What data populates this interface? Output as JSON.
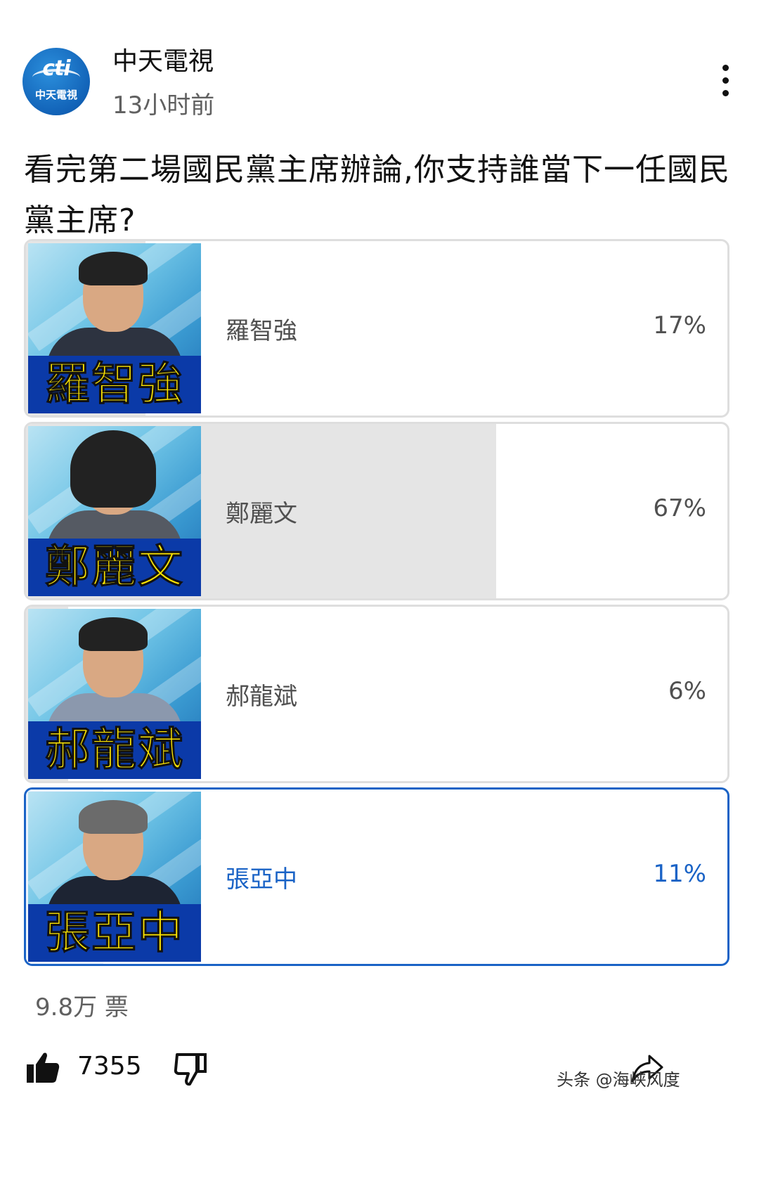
{
  "channel": {
    "name": "中天電視",
    "time": "13小时前",
    "logo_text": "cti",
    "logo_subtext": "中天電視"
  },
  "poll": {
    "question": "看完第二場國民黨主席辦論,你支持誰當下一任國民黨主席?",
    "options": [
      {
        "label": "羅智強",
        "percent_text": "17%",
        "percent": 17,
        "thumb_caption": "羅智強",
        "selected": false
      },
      {
        "label": "鄭麗文",
        "percent_text": "67%",
        "percent": 67,
        "thumb_caption": "鄭麗文",
        "selected": false
      },
      {
        "label": "郝龍斌",
        "percent_text": "6%",
        "percent": 6,
        "thumb_caption": "郝龍斌",
        "selected": false
      },
      {
        "label": "張亞中",
        "percent_text": "11%",
        "percent": 11,
        "thumb_caption": "張亞中",
        "selected": true
      }
    ],
    "votes": "9.8万 票"
  },
  "actions": {
    "like_count": "7355",
    "like_icon": "thumbs-up-icon",
    "dislike_icon": "thumbs-down-icon",
    "share_icon": "share-icon"
  },
  "watermark": "头条 @海峡风度",
  "colors": {
    "selected_accent": "#1a63c6",
    "bar_fill": "#e5e5e5",
    "selected_bar_fill": "#eef4fc",
    "name_banner": "#0b3aa8",
    "name_text": "#ffe600"
  }
}
